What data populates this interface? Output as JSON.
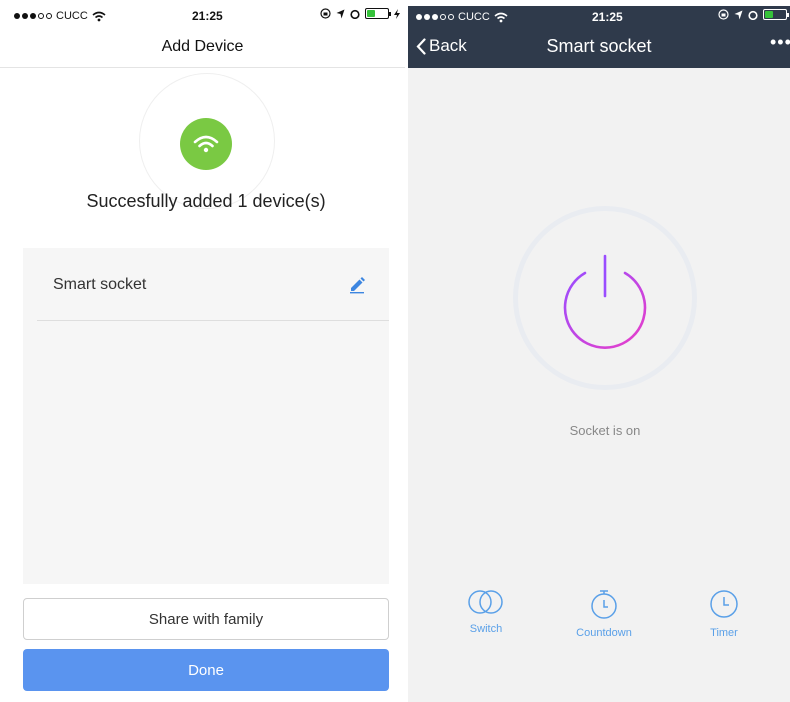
{
  "left": {
    "status": {
      "carrier": "CUCC",
      "time": "21:25"
    },
    "nav": {
      "title": "Add Device"
    },
    "success_text": "Succesfully added 1 device(s)",
    "device": {
      "name": "Smart socket"
    },
    "buttons": {
      "share": "Share with family",
      "done": "Done"
    }
  },
  "right": {
    "status": {
      "carrier": "CUCC",
      "time": "21:25"
    },
    "header": {
      "back_label": "Back",
      "title": "Smart socket",
      "more": "•••"
    },
    "socket_status": "Socket is on",
    "actions": [
      {
        "label": "Switch"
      },
      {
        "label": "Countdown"
      },
      {
        "label": "Timer"
      }
    ]
  },
  "colors": {
    "accent_blue": "#5a94ef",
    "success_green": "#7ac943",
    "header_dark": "#2f3a4b",
    "power_gradient_start": "#9a4dff",
    "power_gradient_end": "#e93ec8",
    "action_blue": "#5aa0e8"
  },
  "icons": {
    "wifi": "wifi-icon",
    "edit": "pencil-icon",
    "power": "power-icon",
    "switch": "toggle-circles-icon",
    "countdown": "stopwatch-icon",
    "timer": "clock-icon"
  }
}
